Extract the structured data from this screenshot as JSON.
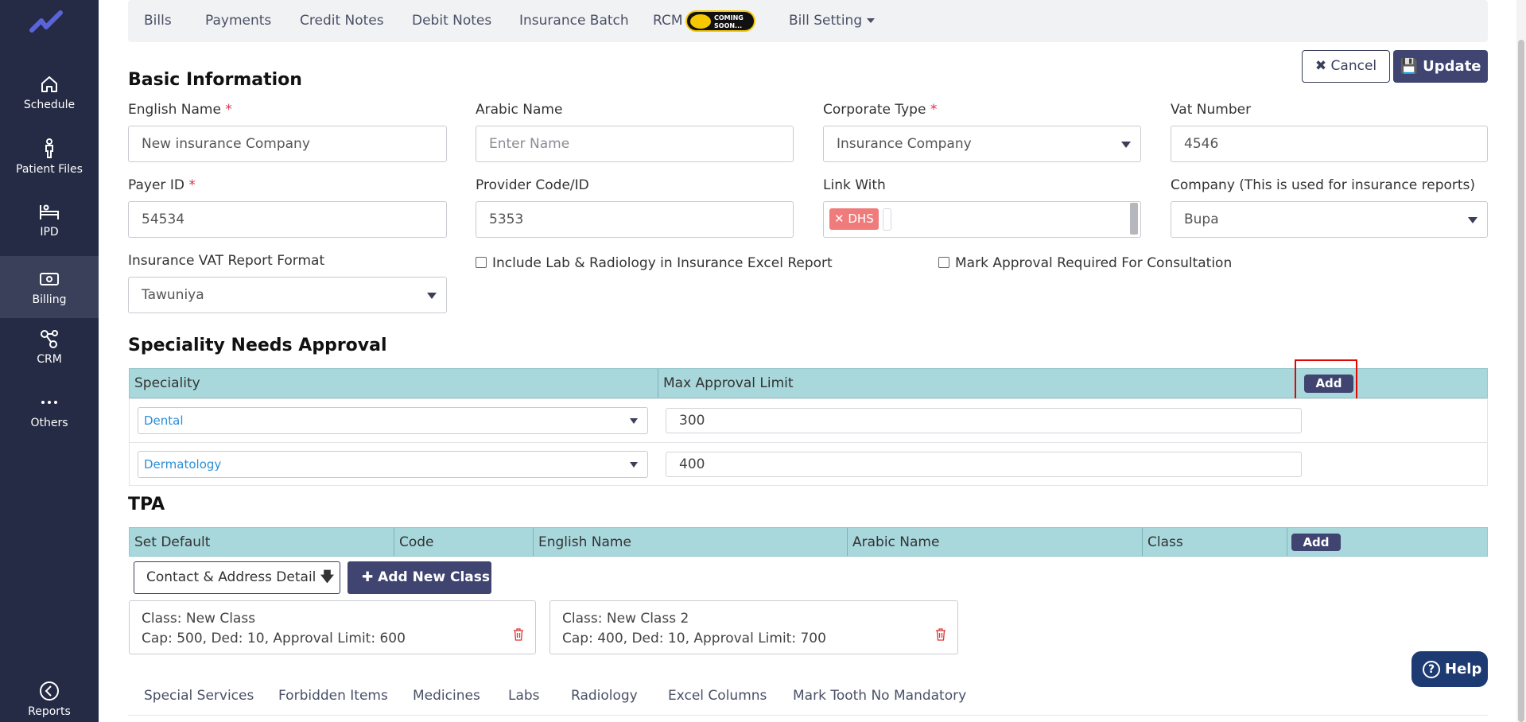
{
  "sidebar": {
    "items": [
      {
        "label": "Schedule",
        "icon": "home-icon"
      },
      {
        "label": "Patient Files",
        "icon": "person-icon"
      },
      {
        "label": "IPD",
        "icon": "bed-icon"
      },
      {
        "label": "Billing",
        "icon": "cash-icon",
        "active": true
      },
      {
        "label": "CRM",
        "icon": "network-icon"
      },
      {
        "label": "Others",
        "icon": "more-icon"
      },
      {
        "label": "Reports",
        "icon": "back-circle-icon"
      }
    ]
  },
  "tabs": {
    "bills": "Bills",
    "payments": "Payments",
    "credit_notes": "Credit Notes",
    "debit_notes": "Debit Notes",
    "insurance_batch": "Insurance Batch",
    "rcm": "RCM",
    "coming_soon_1": "COMING",
    "coming_soon_2": "SOON...",
    "bill_setting": "Bill Setting"
  },
  "actions": {
    "cancel": "Cancel",
    "update": "Update"
  },
  "basic": {
    "title": "Basic Information",
    "english_name_label": "English Name",
    "english_name_value": "New insurance Company",
    "arabic_name_label": "Arabic Name",
    "arabic_name_placeholder": "Enter Name",
    "corporate_type_label": "Corporate Type",
    "corporate_type_value": "Insurance Company",
    "vat_label": "Vat Number",
    "vat_value": "4546",
    "payer_label": "Payer ID",
    "payer_value": "54534",
    "provider_label": "Provider Code/ID",
    "provider_value": "5353",
    "link_label": "Link With",
    "link_chip": "DHS",
    "company_label": "Company (This is used for insurance reports)",
    "company_value": "Bupa",
    "vat_report_label": "Insurance VAT Report Format",
    "vat_report_value": "Tawuniya",
    "include_lab_label": "Include Lab & Radiology in Insurance Excel Report",
    "mark_approval_label": "Mark Approval Required For Consultation",
    "required_mark": "*"
  },
  "speciality": {
    "title": "Speciality Needs Approval",
    "col_speciality": "Speciality",
    "col_limit": "Max Approval Limit",
    "add_label": "Add",
    "rows": [
      {
        "speciality": "Dental",
        "limit": "300"
      },
      {
        "speciality": "Dermatology",
        "limit": "400"
      }
    ]
  },
  "tpa": {
    "title": "TPA",
    "col_default": "Set Default",
    "col_code": "Code",
    "col_english": "English Name",
    "col_arabic": "Arabic Name",
    "col_class": "Class",
    "add_label": "Add",
    "contact_button": "Contact & Address Detail",
    "add_class_button": "Add New Class",
    "classes": [
      {
        "title": "Class: New Class",
        "detail": "Cap: 500, Ded: 10, Approval Limit: 600"
      },
      {
        "title": "Class: New Class 2",
        "detail": "Cap: 400, Ded: 10, Approval Limit: 700"
      }
    ]
  },
  "bottom_tabs": {
    "special_services": "Special Services",
    "forbidden_items": "Forbidden Items",
    "medicines": "Medicines",
    "labs": "Labs",
    "radiology": "Radiology",
    "excel_columns": "Excel Columns",
    "mark_tooth": "Mark Tooth No Mandatory"
  },
  "help": {
    "label": "Help",
    "q": "?"
  },
  "colors": {
    "sidebar": "#252b44",
    "primary": "#3f4470",
    "table_header": "#a8d8dc",
    "required": "#d9304f",
    "chip": "#f07b7b"
  }
}
